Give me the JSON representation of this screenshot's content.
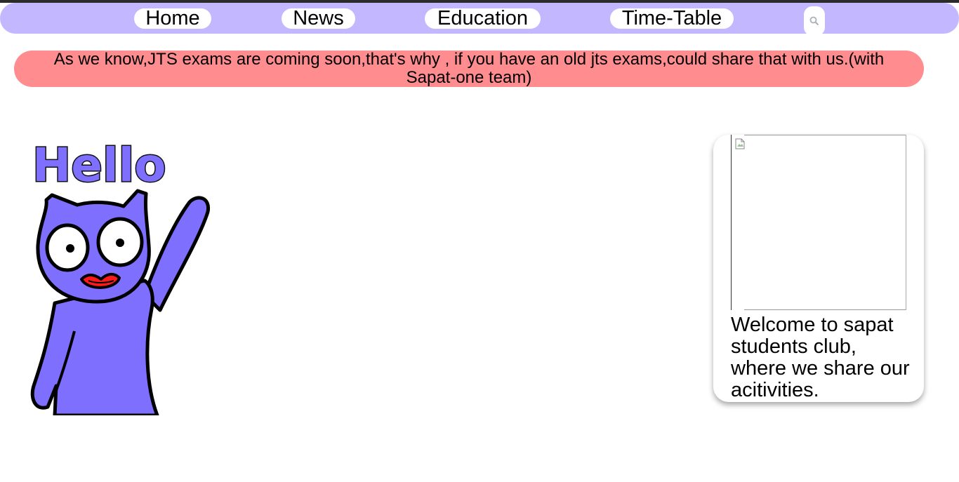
{
  "nav": {
    "items": [
      {
        "label": "Home"
      },
      {
        "label": "News"
      },
      {
        "label": "Education"
      },
      {
        "label": "Time-Table"
      }
    ],
    "search_icon": "search-icon"
  },
  "announcement": {
    "text": "As we know,JTS exams are coming soon,that's why , if you have an old jts exams,could share that with us.(with Sapat-one team)"
  },
  "mascot": {
    "greeting": "Hello"
  },
  "card": {
    "image_icon": "broken-image-icon",
    "text": "Welcome to sapat students club, where we share our acitivities."
  },
  "colors": {
    "nav_bg": "#c3b8ff",
    "announcement_bg": "#ff8c8f",
    "mascot_body": "#7f6fff",
    "mascot_mouth": "#ff1a1a"
  }
}
